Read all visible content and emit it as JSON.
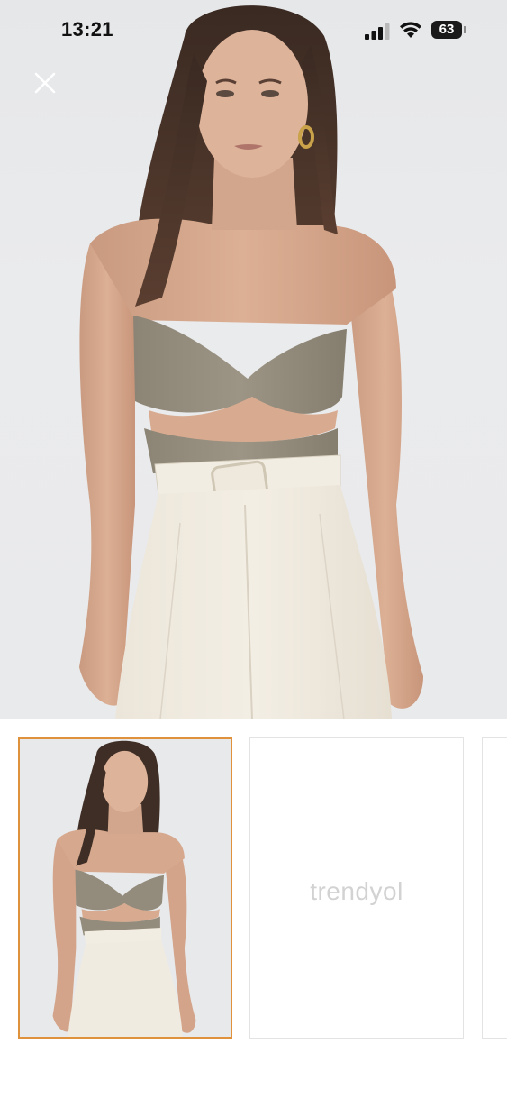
{
  "status_bar": {
    "time": "13:21",
    "battery_level": "63",
    "signal_icon": "cellular-signal-icon",
    "wifi_icon": "wifi-icon"
  },
  "gallery": {
    "close_icon": "close-icon",
    "hero_image": "model wearing khaki twist-front strapless bodysuit with cream trousers",
    "selected_index": 0,
    "thumbnails": [
      {
        "type": "photo",
        "selected": true
      },
      {
        "type": "placeholder",
        "brand": "trendyol",
        "selected": false
      },
      {
        "type": "placeholder",
        "selected": false
      }
    ],
    "accent_color": "#e0913b"
  }
}
